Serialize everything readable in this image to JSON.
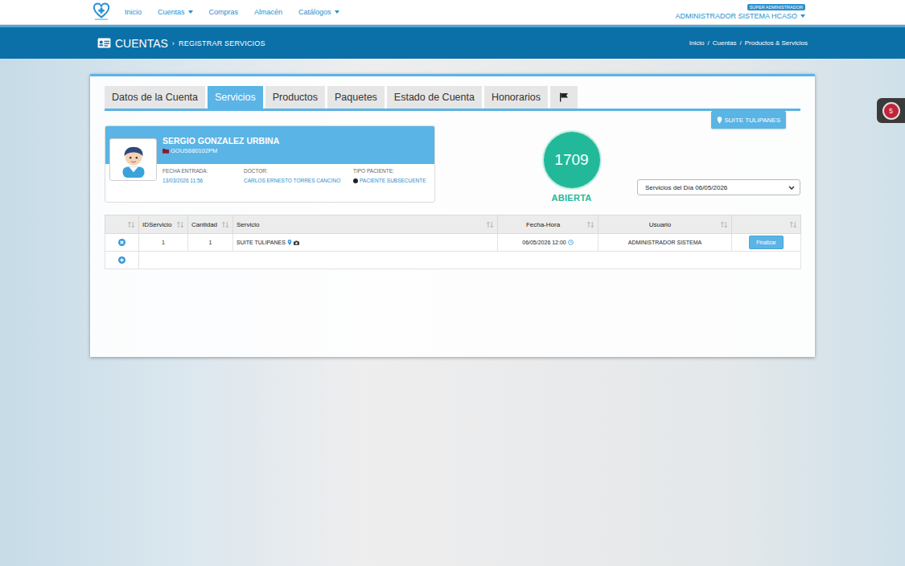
{
  "navbar": {
    "menu": [
      {
        "label": "Inicio",
        "dropdown": false
      },
      {
        "label": "Cuentas",
        "dropdown": true
      },
      {
        "label": "Compras",
        "dropdown": false
      },
      {
        "label": "Almacén",
        "dropdown": false
      },
      {
        "label": "Catálogos",
        "dropdown": true
      }
    ],
    "role_badge": "SUPER ADMINISTRADOR",
    "user": "ADMINISTRADOR SISTEMA HCASO",
    "user_dropdown": true
  },
  "header": {
    "title": "CUENTAS",
    "separator": "›",
    "subtitle": "REGISTRAR SERVICIOS",
    "breadcrumb": [
      "Inicio",
      "Cuentas",
      "Productos & Servicios"
    ],
    "breadcrumb_separator": "/"
  },
  "tabs": [
    {
      "label": "Datos de la Cuenta",
      "selected": false,
      "kind": "text"
    },
    {
      "label": "Servicios",
      "selected": true,
      "kind": "text"
    },
    {
      "label": "Productos",
      "selected": false,
      "kind": "text"
    },
    {
      "label": "Paquetes",
      "selected": false,
      "kind": "text"
    },
    {
      "label": "Estado de Cuenta",
      "selected": false,
      "kind": "text"
    },
    {
      "label": "Honorarios",
      "selected": false,
      "kind": "text"
    },
    {
      "selected": false,
      "kind": "icon"
    }
  ],
  "location_button": "SUITE TULIPANES",
  "patient": {
    "name": "SERGIO GONZALEZ URBINA",
    "rfc": "GOUS680102PM",
    "fields": [
      {
        "label": "FECHA ENTRADA:",
        "value": "13/03/2026 11:56",
        "kind": "text"
      },
      {
        "label": "DOCTOR:",
        "value": "CARLOS ERNESTO TORRES CANCINO",
        "kind": "text"
      },
      {
        "label": "TIPO PACIENTE:",
        "value": "PACIENTE SUBSECUENTE",
        "kind": "status",
        "color": "#222222"
      }
    ]
  },
  "account": {
    "number": "1709",
    "status": "ABIERTA"
  },
  "day_filter": {
    "value": "Servicios del Día 06/05/2026"
  },
  "table": {
    "columns": [
      "",
      "IDServicio",
      "Cantidad",
      "Servicio",
      "Fecha-Hora",
      "Usuario",
      ""
    ],
    "rows": [
      {
        "id": "1",
        "quantity": "1",
        "service": "SUITE TULIPANES",
        "datetime": "06/05/2026 12:00",
        "user": "ADMINISTRADOR SISTEMA",
        "action": "Finalizar"
      }
    ]
  },
  "notifications": {
    "count": "5"
  }
}
